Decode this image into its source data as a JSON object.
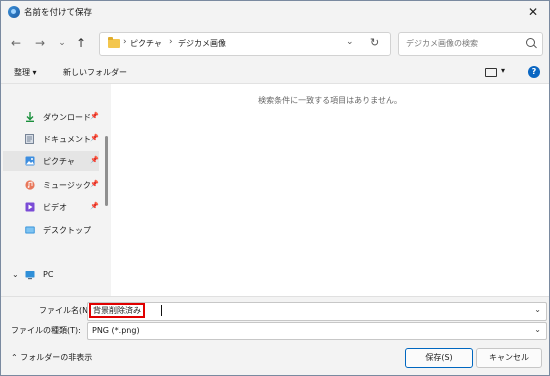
{
  "window": {
    "title": "名前を付けて保存",
    "close_label": "✕"
  },
  "nav": {
    "back": "←",
    "forward": "→",
    "recent": "⌄",
    "up": "↑",
    "breadcrumbs": [
      "ピクチャ",
      "デジカメ画像"
    ],
    "separator": "›",
    "dropdown": "⌄",
    "refresh": "↻",
    "search_placeholder": "デジカメ画像の検索"
  },
  "toolbar": {
    "organize": "整理 ▾",
    "new_folder": "新しいフォルダー",
    "view_dropdown": "▾",
    "help": "?"
  },
  "sidebar": {
    "items": [
      {
        "label": "ダウンロード",
        "icon": "download-icon",
        "pinned": true,
        "selected": false
      },
      {
        "label": "ドキュメント",
        "icon": "document-icon",
        "pinned": true,
        "selected": false
      },
      {
        "label": "ピクチャ",
        "icon": "pictures-icon",
        "pinned": true,
        "selected": true
      },
      {
        "label": "ミュージック",
        "icon": "music-icon",
        "pinned": true,
        "selected": false
      },
      {
        "label": "ビデオ",
        "icon": "video-icon",
        "pinned": true,
        "selected": false
      },
      {
        "label": "デスクトップ",
        "icon": "desktop-icon",
        "pinned": false,
        "selected": false
      }
    ],
    "pc_label": "PC",
    "pin_glyph": "📌",
    "expand_glyph": "⌄"
  },
  "content": {
    "empty_message": "検索条件に一致する項目はありません。"
  },
  "form": {
    "filename_label": "ファイル名(N):",
    "filename_value": "背景削除済み",
    "filetype_label": "ファイルの種類(T):",
    "filetype_value": "PNG (*.png)",
    "dropdown": "⌄"
  },
  "footer": {
    "hide_folders": "⌃ フォルダーの非表示",
    "save_button": "保存(S)",
    "cancel_button": "キャンセル"
  },
  "colors": {
    "accent": "#0067c0",
    "highlight_border": "#e00000",
    "folder": "#f3c64e"
  }
}
